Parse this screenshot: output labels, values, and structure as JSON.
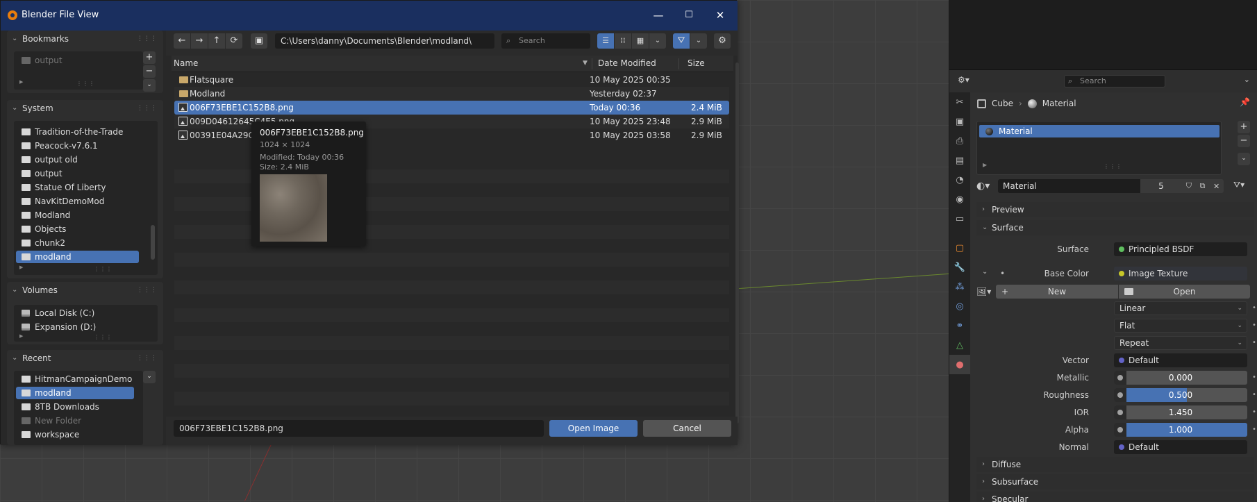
{
  "dialog": {
    "title": "Blender File View",
    "window_buttons": [
      "—",
      "☐",
      "✕"
    ],
    "bookmarks": {
      "header": "Bookmarks",
      "items": [
        "output"
      ]
    },
    "system": {
      "header": "System",
      "items": [
        "Tradition-of-the-Trade",
        "Peacock-v7.6.1",
        "output old",
        "output",
        "Statue Of Liberty",
        "NavKitDemoMod",
        "Modland",
        "Objects",
        "chunk2",
        "modland"
      ],
      "selected": "modland"
    },
    "volumes": {
      "header": "Volumes",
      "items": [
        "Local Disk (C:)",
        "Expansion (D:)"
      ]
    },
    "recent": {
      "header": "Recent",
      "items": [
        "HitmanCampaignDemo",
        "modland",
        "8TB Downloads",
        "New Folder",
        "workspace"
      ],
      "selected": "modland"
    },
    "toolbar": {
      "nav": [
        "←",
        "→",
        "↑",
        "⟳"
      ],
      "new_folder_icon": "new-folder-icon",
      "path": "C:\\Users\\danny\\Documents\\Blender\\modland\\",
      "search_placeholder": "Search"
    },
    "columns": {
      "name": "Name",
      "date": "Date Modified",
      "size": "Size"
    },
    "files": [
      {
        "name": "Flatsquare",
        "date": "10 May 2025 00:35",
        "size": "",
        "type": "folder"
      },
      {
        "name": "Modland",
        "date": "Yesterday 02:37",
        "size": "",
        "type": "folder"
      },
      {
        "name": "006F73EBE1C152B8.png",
        "date": "Today 00:36",
        "size": "2.4 MiB",
        "type": "image",
        "selected": true
      },
      {
        "name": "009D04612645C4E5.png",
        "date": "10 May 2025 23:48",
        "size": "2.9 MiB",
        "type": "image"
      },
      {
        "name": "00391E04A29CE",
        "date": "10 May 2025 03:58",
        "size": "2.9 MiB",
        "type": "image"
      }
    ],
    "tooltip": {
      "name": "006F73EBE1C152B8.png",
      "dims": "1024 × 1024",
      "modified": "Modified: Today 00:36",
      "size": "Size: 2.4 MiB"
    },
    "filename": "006F73EBE1C152B8.png",
    "open_label": "Open Image",
    "cancel_label": "Cancel"
  },
  "properties": {
    "search_placeholder": "Search",
    "breadcrumb": {
      "object": "Cube",
      "material": "Material"
    },
    "slot_name": "Material",
    "material_name": "Material",
    "users": "5",
    "sections": {
      "preview": "Preview",
      "surface": "Surface",
      "diffuse": "Diffuse",
      "subsurface": "Subsurface",
      "specular": "Specular"
    },
    "surface": {
      "label": "Surface",
      "value": "Principled BSDF"
    },
    "base_color": {
      "label": "Base Color",
      "value": "Image Texture"
    },
    "new_label": "New",
    "open_label": "Open",
    "interpolation": "Linear",
    "projection": "Flat",
    "extension": "Repeat",
    "vector": {
      "label": "Vector",
      "value": "Default"
    },
    "metallic": {
      "label": "Metallic",
      "value": "0.000",
      "fill": 0.0
    },
    "roughness": {
      "label": "Roughness",
      "value": "0.500",
      "fill": 0.5
    },
    "ior": {
      "label": "IOR",
      "value": "1.450",
      "fill": 0.0
    },
    "alpha": {
      "label": "Alpha",
      "value": "1.000",
      "fill": 1.0
    },
    "normal": {
      "label": "Normal",
      "value": "Default"
    }
  },
  "colors": {
    "accent": "#4772b3",
    "titlebar": "#1a2f5f"
  }
}
